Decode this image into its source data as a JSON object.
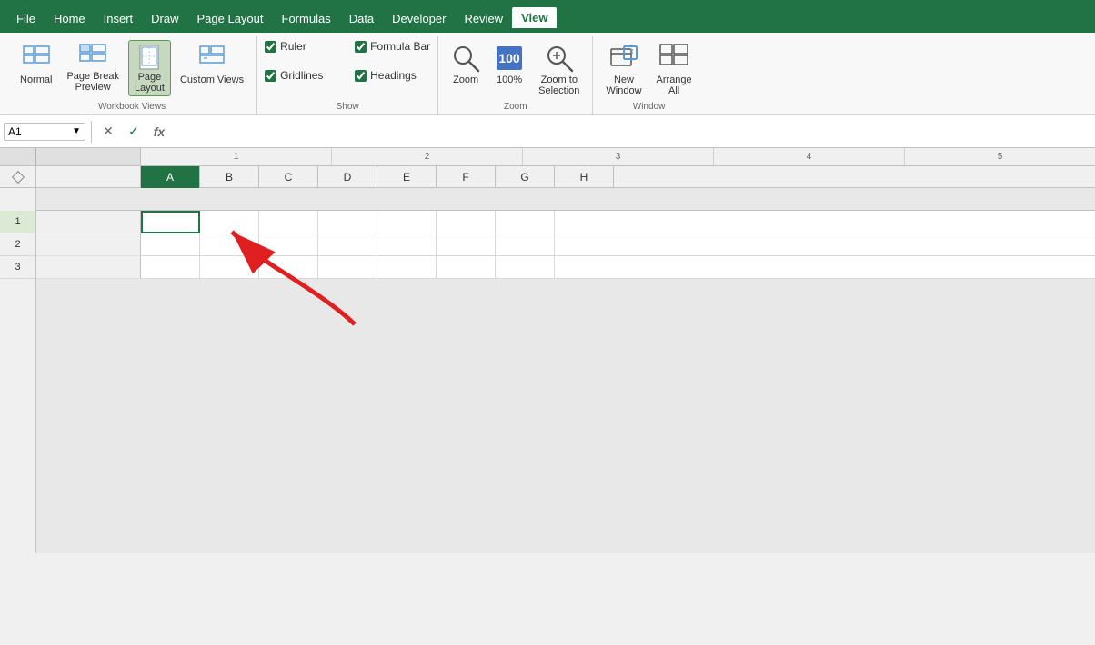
{
  "titlebar": {
    "accent_color": "#217346"
  },
  "menubar": {
    "items": [
      "File",
      "Home",
      "Insert",
      "Draw",
      "Page Layout",
      "Formulas",
      "Data",
      "Developer",
      "Review",
      "View"
    ],
    "active": "View"
  },
  "ribbon": {
    "groups": [
      {
        "name": "Workbook Views",
        "label": "Workbook Views",
        "buttons": [
          {
            "id": "normal",
            "label": "Normal",
            "icon": "normal-view"
          },
          {
            "id": "page-break",
            "label": "Page Break\nPreview",
            "icon": "page-break-view"
          },
          {
            "id": "page-layout",
            "label": "Page\nLayout",
            "icon": "page-layout-view",
            "active": true
          },
          {
            "id": "custom-views",
            "label": "Custom\nViews",
            "icon": "custom-views"
          }
        ]
      },
      {
        "name": "Show",
        "label": "Show",
        "checks": [
          {
            "id": "ruler",
            "label": "Ruler",
            "checked": true
          },
          {
            "id": "formula-bar",
            "label": "Formula Bar",
            "checked": true
          },
          {
            "id": "gridlines",
            "label": "Gridlines",
            "checked": true
          },
          {
            "id": "headings",
            "label": "Headings",
            "checked": true
          }
        ]
      },
      {
        "name": "Zoom",
        "label": "Zoom",
        "buttons": [
          {
            "id": "zoom",
            "label": "Zoom",
            "icon": "zoom-icon"
          },
          {
            "id": "zoom-100",
            "label": "100%",
            "icon": "zoom-100-icon"
          },
          {
            "id": "zoom-selection",
            "label": "Zoom to\nSelection",
            "icon": "zoom-selection-icon"
          }
        ]
      },
      {
        "name": "Window",
        "label": "Window",
        "buttons": [
          {
            "id": "new-window",
            "label": "New\nWindow",
            "icon": "new-window-icon"
          },
          {
            "id": "arrange-all",
            "label": "Arrange\nAll",
            "icon": "arrange-all-icon"
          }
        ]
      }
    ]
  },
  "formula_bar": {
    "cell_ref": "A1",
    "formula": ""
  },
  "ruler": {
    "ticks": [
      "1",
      "2",
      "3",
      "4",
      "5"
    ]
  },
  "columns": [
    "A",
    "B",
    "C",
    "D",
    "E",
    "F",
    "G",
    "H"
  ],
  "rows": [
    {
      "num": "1",
      "cells": [
        "",
        "",
        "",
        "",
        "",
        "",
        "",
        ""
      ]
    },
    {
      "num": "2",
      "cells": [
        "",
        "",
        "",
        "",
        "",
        "",
        "",
        ""
      ]
    },
    {
      "num": "3",
      "cells": [
        "",
        "",
        "",
        "",
        "",
        "",
        "",
        ""
      ]
    }
  ],
  "annotation": {
    "arrow_color": "#e02020"
  }
}
